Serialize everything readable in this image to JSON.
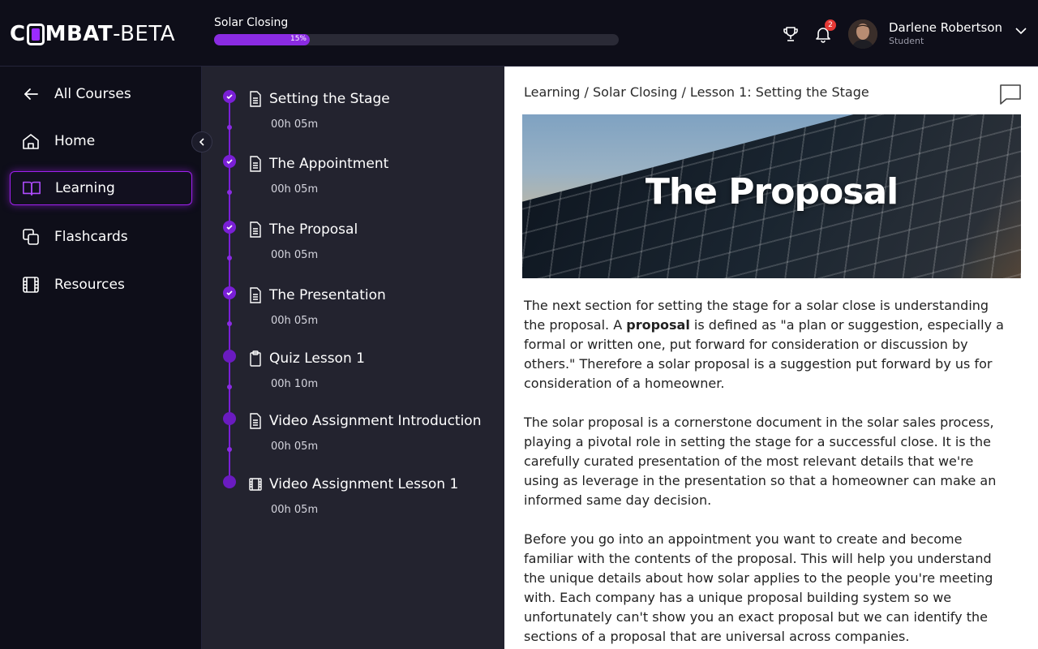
{
  "app": {
    "logo_prefix": "C",
    "logo_suffix": "MBAT",
    "logo_beta": "-BETA"
  },
  "header": {
    "course_name": "Solar Closing",
    "progress_value": 15,
    "progress_label": "15%",
    "notification_count": "2",
    "user_name": "Darlene Robertson",
    "user_role": "Student"
  },
  "sidebar": {
    "items": [
      {
        "label": "All Courses",
        "icon": "arrow-left-icon"
      },
      {
        "label": "Home",
        "icon": "home-icon"
      },
      {
        "label": "Learning",
        "icon": "book-open-icon",
        "active": true
      },
      {
        "label": "Flashcards",
        "icon": "cards-icon"
      },
      {
        "label": "Resources",
        "icon": "film-icon"
      }
    ]
  },
  "lessons": [
    {
      "title": "Setting the Stage",
      "duration": "00h 05m",
      "icon": "document-icon",
      "completed": true
    },
    {
      "title": "The Appointment",
      "duration": "00h 05m",
      "icon": "document-icon",
      "completed": true
    },
    {
      "title": "The Proposal",
      "duration": "00h 05m",
      "icon": "document-icon",
      "completed": true
    },
    {
      "title": "The Presentation",
      "duration": "00h 05m",
      "icon": "document-icon",
      "completed": true
    },
    {
      "title": "Quiz Lesson 1",
      "duration": "00h 10m",
      "icon": "clipboard-icon",
      "completed": false
    },
    {
      "title": "Video Assignment Introduction",
      "duration": "00h 05m",
      "icon": "document-icon",
      "completed": false
    },
    {
      "title": "Video Assignment Lesson 1",
      "duration": "00h 05m",
      "icon": "film-icon",
      "completed": false
    }
  ],
  "main": {
    "breadcrumb": "Learning / Solar Closing / Lesson 1: Setting the Stage",
    "hero_title": "The Proposal",
    "p1_before": "The next section for setting the stage for a solar close is understanding the proposal. A ",
    "p1_bold": "proposal",
    "p1_after": " is defined as \"a plan or suggestion, especially a formal or written one, put forward for consideration or discussion by others.\" Therefore a solar proposal is a suggestion put forward by us for consideration of a homeowner.",
    "p2": "The solar proposal is a cornerstone document in the solar sales process, playing a pivotal role in setting the stage for a successful close. It is the carefully curated presentation of the most relevant details that we're using as leverage in the presentation so that a homeowner can make an informed same day decision.",
    "p3": "Before you go into an appointment you want to create and become familiar with the contents of the proposal. This will help you understand the unique details about how solar applies to the people you're meeting with. Each company has a unique proposal building system so we unfortunately can't show you an exact proposal but we can identify the sections of a proposal that are universal across companies."
  },
  "colors": {
    "accent": "#8a2be2",
    "background": "#0e0e19",
    "lessons_bg": "#23232f"
  }
}
